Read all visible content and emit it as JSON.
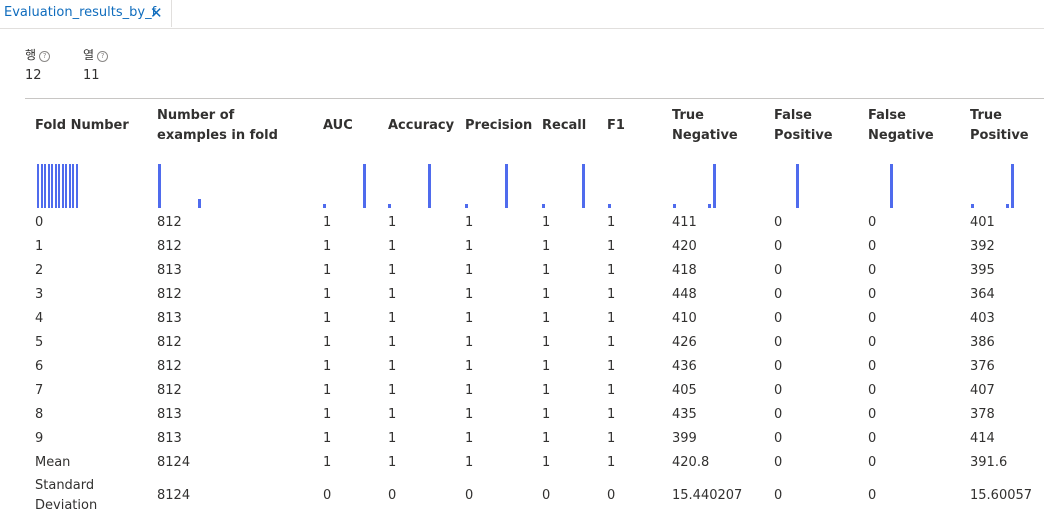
{
  "tab": {
    "title": "Evaluation_results_by_f",
    "close_icon": "close-icon"
  },
  "summary": {
    "rows_label": "행",
    "rows_value": "12",
    "cols_label": "열",
    "cols_value": "11",
    "help_icon": "help-circle-icon"
  },
  "columns": [
    {
      "key": "fold",
      "label": "Fold Number",
      "spark": {
        "type": "uniform",
        "count": 12
      }
    },
    {
      "key": "n",
      "label": "Number of examples in fold",
      "spark": {
        "type": "bins",
        "levels": [
          1.0,
          0.0,
          0.2
        ]
      }
    },
    {
      "key": "auc",
      "label": "AUC",
      "spark": {
        "type": "bins",
        "levels": [
          0.08,
          0.0,
          1.0
        ]
      }
    },
    {
      "key": "acc",
      "label": "Accuracy",
      "spark": {
        "type": "bins",
        "levels": [
          0.08,
          0.0,
          1.0
        ]
      }
    },
    {
      "key": "prec",
      "label": "Precision",
      "spark": {
        "type": "bins",
        "levels": [
          0.08,
          0.0,
          1.0
        ]
      }
    },
    {
      "key": "rec",
      "label": "Recall",
      "spark": {
        "type": "bins",
        "levels": [
          0.08,
          0.0,
          1.0
        ]
      }
    },
    {
      "key": "f1",
      "label": "F1",
      "spark": {
        "type": "bins",
        "levels": [
          1.0,
          0.0,
          0.08
        ]
      }
    },
    {
      "key": "tn",
      "label": "True Negative",
      "spark": {
        "type": "bins",
        "levels": [
          0.08,
          0.0,
          0.08,
          1.0
        ]
      }
    },
    {
      "key": "fp",
      "label": "False Positive",
      "spark": {
        "type": "bins",
        "levels": [
          1.0
        ]
      }
    },
    {
      "key": "fn",
      "label": "False Negative",
      "spark": {
        "type": "bins",
        "levels": [
          1.0
        ]
      }
    },
    {
      "key": "tp",
      "label": "True Positive",
      "spark": {
        "type": "bins",
        "levels": [
          0.08,
          0.0,
          0.08,
          1.0
        ]
      }
    }
  ],
  "rows": [
    [
      "0",
      "812",
      "1",
      "1",
      "1",
      "1",
      "1",
      "411",
      "0",
      "0",
      "401"
    ],
    [
      "1",
      "812",
      "1",
      "1",
      "1",
      "1",
      "1",
      "420",
      "0",
      "0",
      "392"
    ],
    [
      "2",
      "813",
      "1",
      "1",
      "1",
      "1",
      "1",
      "418",
      "0",
      "0",
      "395"
    ],
    [
      "3",
      "812",
      "1",
      "1",
      "1",
      "1",
      "1",
      "448",
      "0",
      "0",
      "364"
    ],
    [
      "4",
      "813",
      "1",
      "1",
      "1",
      "1",
      "1",
      "410",
      "0",
      "0",
      "403"
    ],
    [
      "5",
      "812",
      "1",
      "1",
      "1",
      "1",
      "1",
      "426",
      "0",
      "0",
      "386"
    ],
    [
      "6",
      "812",
      "1",
      "1",
      "1",
      "1",
      "1",
      "436",
      "0",
      "0",
      "376"
    ],
    [
      "7",
      "812",
      "1",
      "1",
      "1",
      "1",
      "1",
      "405",
      "0",
      "0",
      "407"
    ],
    [
      "8",
      "813",
      "1",
      "1",
      "1",
      "1",
      "1",
      "435",
      "0",
      "0",
      "378"
    ],
    [
      "9",
      "813",
      "1",
      "1",
      "1",
      "1",
      "1",
      "399",
      "0",
      "0",
      "414"
    ],
    [
      "Mean",
      "8124",
      "1",
      "1",
      "1",
      "1",
      "1",
      "420.8",
      "0",
      "0",
      "391.6"
    ],
    [
      "Standard Deviation",
      "8124",
      "0",
      "0",
      "0",
      "0",
      "0",
      "15.440207",
      "0",
      "0",
      "15.60057"
    ]
  ],
  "colors": {
    "accent": "#0f6cbd",
    "bar": "#4f6bed",
    "divider": "#c8c6c4"
  }
}
